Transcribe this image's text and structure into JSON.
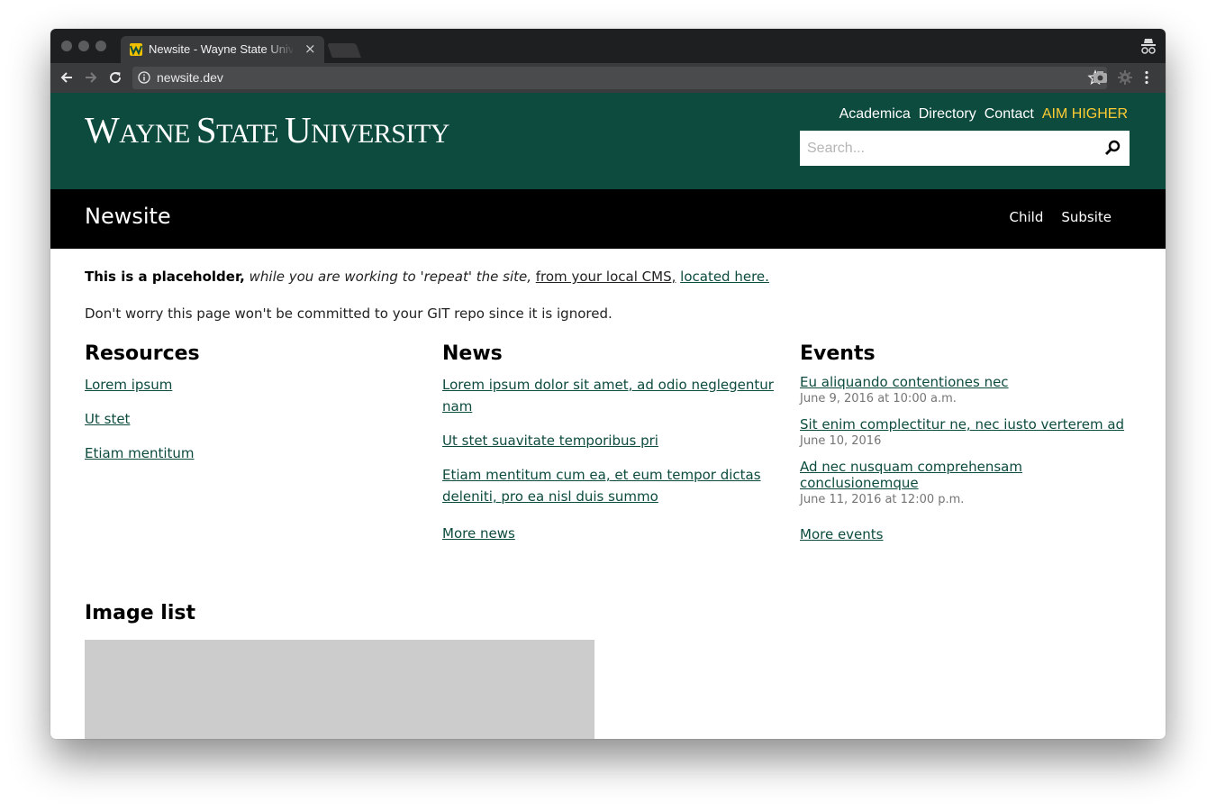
{
  "browser": {
    "tab_title": "Newsite - Wayne State University",
    "tab_close": "×",
    "url": "newsite.dev"
  },
  "header": {
    "logo": {
      "w": "W",
      "ayne": "AYNE",
      "s": "S",
      "tate": "TATE",
      "u": "U",
      "niversity": "NIVERSITY"
    },
    "util_nav": [
      "Academica",
      "Directory",
      "Contact",
      "AIM HIGHER"
    ],
    "search_placeholder": "Search..."
  },
  "site_bar": {
    "title": "Newsite",
    "menu": [
      "Child",
      "Subsite"
    ]
  },
  "content": {
    "notice_bold": "This is a placeholder,",
    "notice_italic": "while you are working to 'repeat' the site,",
    "notice_link1": "from your local CMS,",
    "notice_link2": "located here.",
    "notice2": "Don't worry this page won't be committed to your GIT repo since it is ignored."
  },
  "resources": {
    "heading": "Resources",
    "items": [
      "Lorem ipsum",
      "Ut stet",
      "Etiam mentitum"
    ]
  },
  "news": {
    "heading": "News",
    "items": [
      "Lorem ipsum dolor sit amet, ad odio neglegentur nam",
      "Ut stet suavitate temporibus pri",
      "Etiam mentitum cum ea, et eum tempor dictas deleniti, pro ea nisl duis summo"
    ],
    "more": "More news"
  },
  "events": {
    "heading": "Events",
    "items": [
      {
        "title": "Eu aliquando contentiones nec",
        "date": "June 9, 2016 at 10:00 a.m."
      },
      {
        "title": "Sit enim complectitur ne, nec iusto verterem ad",
        "date": "June 10, 2016"
      },
      {
        "title": "Ad nec nusquam comprehensam conclusionemque",
        "date": "June 11, 2016 at 12:00 p.m."
      }
    ],
    "more": "More events"
  },
  "image_list": {
    "heading": "Image list"
  },
  "colors": {
    "wsu_green": "#0c4b3e",
    "wsu_gold": "#ffcc33",
    "site_bar": "#000000"
  }
}
